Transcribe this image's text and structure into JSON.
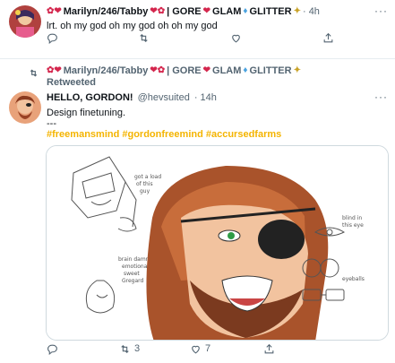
{
  "tweet1": {
    "display_name": "Marilyn/246/Tabby",
    "tag_text": "| GORE",
    "tag_glam": "GLAM",
    "tag_glitter": "GLITTER",
    "time": "· 4h",
    "text": "lrt. oh my god oh my god oh oh my god",
    "more": "···"
  },
  "tweet2": {
    "rt_display_name": "Marilyn/246/Tabby",
    "rt_tag_text": "| GORE",
    "rt_tag_glam": "GLAM",
    "rt_tag_glitter": "GLITTER",
    "retweeted_label": "Retweeted",
    "author_name": "HELLO, GORDON!",
    "author_handle": "@hevsuited",
    "time": "· 14h",
    "text": "Design finetuning.",
    "dashes": "---",
    "hashtags": "#freemansmind #gordonfreemind #accursedfarms",
    "retweet_count": "3",
    "like_count": "7",
    "more": "···"
  },
  "icons": {
    "reply": "reply-icon",
    "retweet": "retweet-icon",
    "like": "heart-icon",
    "share": "share-icon"
  },
  "colors": {
    "hashtag": "#f4b400",
    "muted": "#536471",
    "border": "#e6ecf0"
  }
}
